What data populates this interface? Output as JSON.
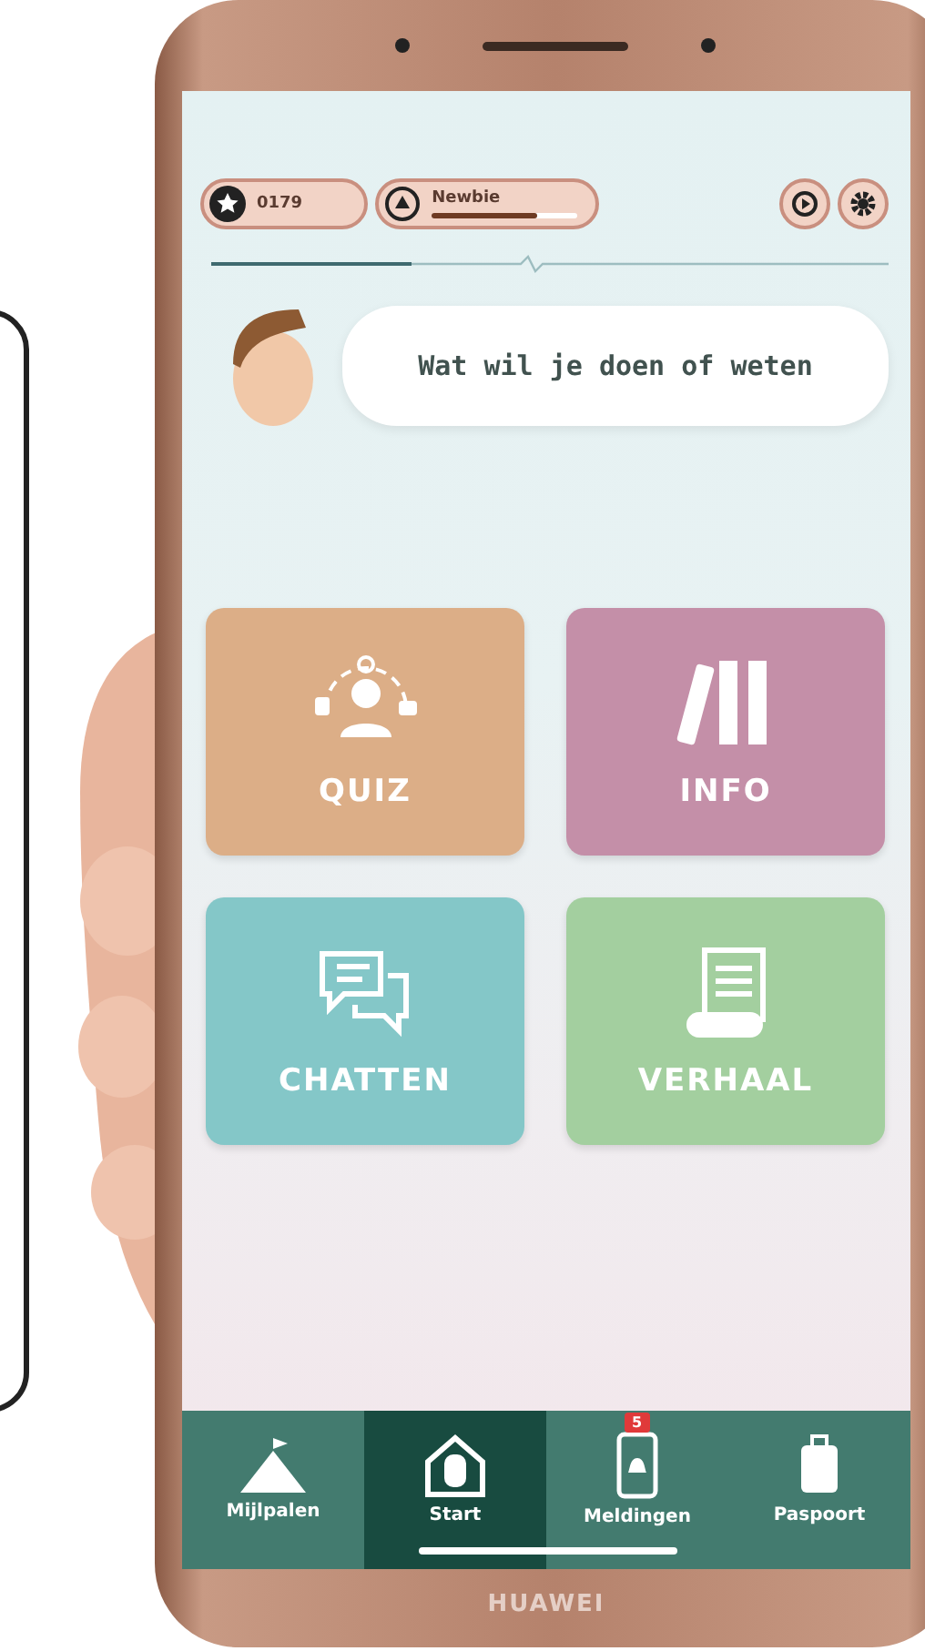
{
  "stats": {
    "points": "0179",
    "rank": "Newbie",
    "level": 0.72
  },
  "greeting": "Wat wil je doen of weten",
  "tiles": [
    {
      "label": "QUIZ",
      "kind": "quiz",
      "color": "#dcae87"
    },
    {
      "label": "INFO",
      "kind": "info",
      "color": "#c48fa8"
    },
    {
      "label": "CHATTEN",
      "kind": "chat",
      "color": "#84c7c8"
    },
    {
      "label": "VERHAAL",
      "kind": "story",
      "color": "#a3cf9f"
    }
  ],
  "nav": [
    {
      "label": "Mijlpalen",
      "kind": "mountain",
      "selected": false
    },
    {
      "label": "Start",
      "kind": "home",
      "selected": true
    },
    {
      "label": "Meldingen",
      "kind": "phone",
      "selected": false,
      "badge": "5"
    },
    {
      "label": "Paspoort",
      "kind": "luggage",
      "selected": false
    }
  ],
  "device": {
    "brand": "HUAWEI"
  }
}
